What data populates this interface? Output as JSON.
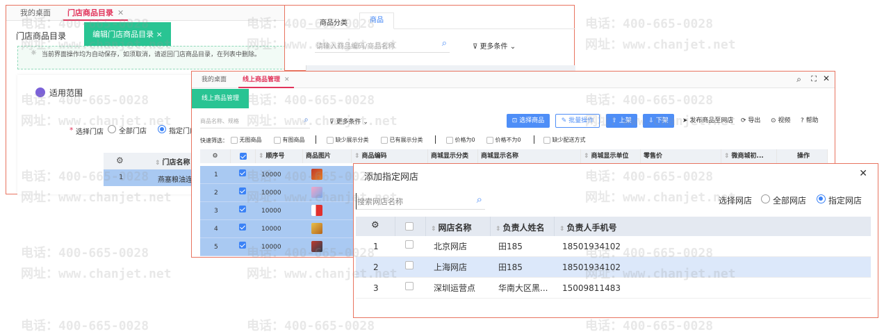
{
  "watermark": {
    "phone": "电话：400-665-0028",
    "site": "网址：www.chanjet.net"
  },
  "win1": {
    "tab_home": "我的桌面",
    "tab_active": "门店商品目录",
    "tab_close": "✕",
    "breadcrumb": "门店商品目录",
    "edit_button": "编辑门店商品目录",
    "edit_close": "×",
    "notice": "当前界面操作均为自动保存，如须取消，请返回门店商品目录，在列表中删除。",
    "section_title": "适用范围",
    "select_label": "选择门店",
    "required_mark": "*",
    "radio_all": "全部门店",
    "radio_specific": "指定门店",
    "col_name": "门店名称",
    "row": {
      "index": "1",
      "name": "燕塞粮油连..."
    }
  },
  "win2": {
    "tab_category": "商品分类",
    "tab_product": "商品",
    "search_placeholder": "请输入商品编码/商品名称",
    "more_filter": "更多条件"
  },
  "win3": {
    "tab_home": "我的桌面",
    "tab_active": "线上商品管理",
    "tab_close": "✕",
    "section_button": "线上商品管理",
    "search_placeholder": "商品名称、规格",
    "more_filter": "更多条件",
    "toolbar": {
      "select": "选择商品",
      "batch": "批量操作",
      "on_shelf": "上架",
      "off_shelf": "下架",
      "publish": "发布商品至网店",
      "export": "导出",
      "video": "视频",
      "help": "帮助"
    },
    "quick_filter": {
      "label": "快速筛选：",
      "items": [
        "无图商品",
        "有图商品",
        "缺少展示分类",
        "已有展示分类",
        "价格为0",
        "价格不为0",
        "缺少配送方式"
      ]
    },
    "columns": {
      "seq": "顺序号",
      "image": "商品图片",
      "code": "商品编码",
      "display_cat": "商城显示分类",
      "display_name": "商城显示名称",
      "display_unit": "商城显示单位",
      "price": "零售价",
      "wechat": "微商城初...",
      "action": "操作"
    },
    "rows": [
      {
        "index": "1",
        "seq": "10000"
      },
      {
        "index": "2",
        "seq": "10000"
      },
      {
        "index": "3",
        "seq": "10000"
      },
      {
        "index": "4",
        "seq": "10000"
      },
      {
        "index": "5",
        "seq": "10000"
      }
    ]
  },
  "modal": {
    "title": "添加指定网店",
    "close": "✕",
    "search_placeholder": "搜索网店名称",
    "select_label": "选择网店",
    "radio_all": "全部网店",
    "radio_specific": "指定网店",
    "columns": {
      "name": "网店名称",
      "manager": "负责人姓名",
      "phone": "负责人手机号"
    },
    "rows": [
      {
        "index": "1",
        "name": "北京网店",
        "manager": "田185",
        "phone": "18501934102"
      },
      {
        "index": "2",
        "name": "上海网店",
        "manager": "田185",
        "phone": "18501934102"
      },
      {
        "index": "3",
        "name": "深圳运营点",
        "manager": "华南大区黑...",
        "phone": "15009811483"
      }
    ]
  },
  "colors": {
    "accent": "#e1335a",
    "green": "#29c493",
    "blue": "#4e8ef7",
    "selected_row": "#a9c9f2",
    "modal_row_selected": "#dce8fa",
    "window_border": "#e8735f"
  }
}
